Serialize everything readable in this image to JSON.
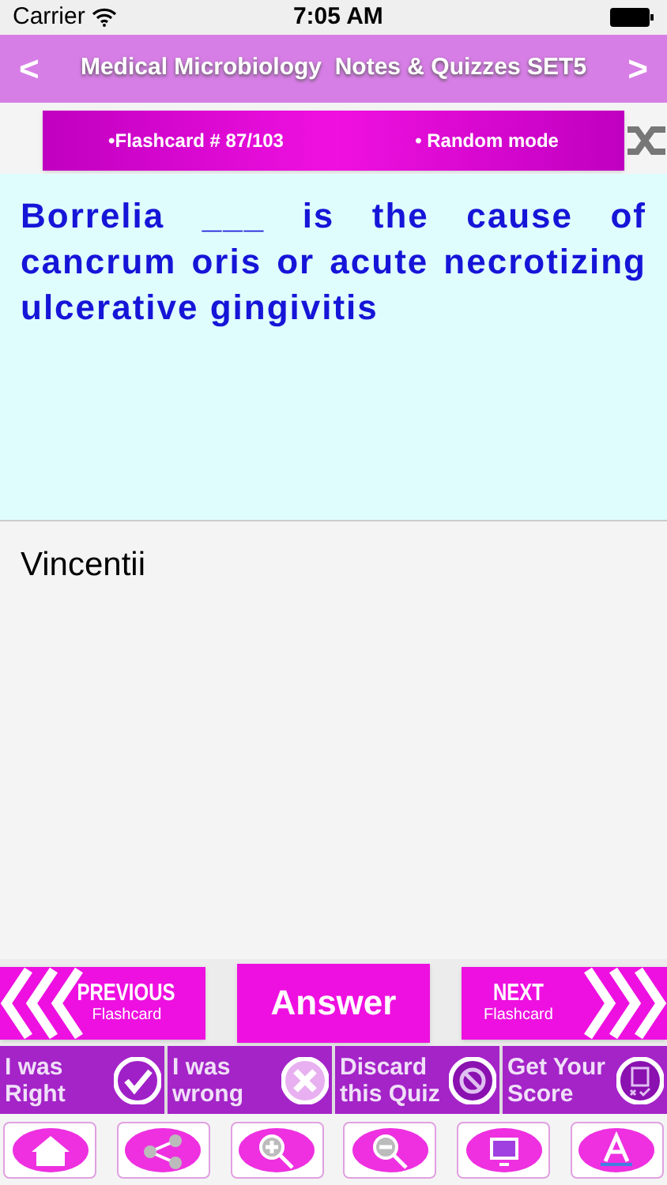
{
  "status_bar": {
    "carrier": "Carrier",
    "time": "7:05 AM"
  },
  "header": {
    "back": "<",
    "title": "Medical Microbiology  Notes & Quizzes SET5",
    "forward": ">"
  },
  "flashcard_bar": {
    "counter": "•Flashcard #  87/103",
    "mode": "• Random mode"
  },
  "question": "Borrelia ___ is the cause of cancrum oris or acute necrotizing ulcerative gingivitis",
  "answer": "Vincentii",
  "nav": {
    "previous": {
      "label": "PREVIOUS",
      "sublabel": "Flashcard"
    },
    "answer": "Answer",
    "next": {
      "label": "NEXT",
      "sublabel": "Flashcard"
    }
  },
  "actions": [
    {
      "kind": "right",
      "lines": [
        "I was",
        "Right"
      ]
    },
    {
      "kind": "wrong",
      "lines": [
        "I was",
        "wrong"
      ]
    },
    {
      "kind": "discard",
      "lines": [
        "Discard",
        "this Quiz"
      ]
    },
    {
      "kind": "score",
      "lines": [
        "Get Your",
        "Score"
      ]
    }
  ]
}
